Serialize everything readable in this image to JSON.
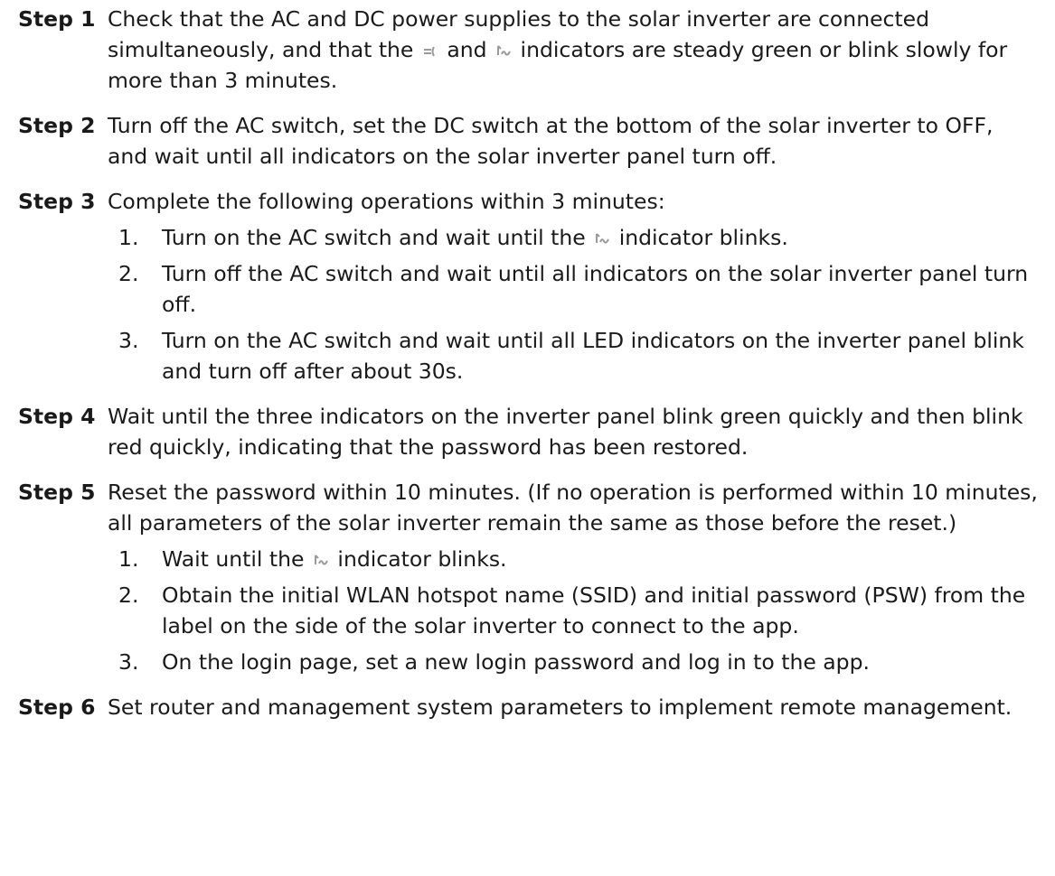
{
  "steps": [
    {
      "label": "Step 1",
      "parts": [
        "Check that the AC and DC power supplies to the solar inverter are connected simultaneously, and that the",
        "and",
        "indicators are steady green or blink slowly for more than 3 minutes."
      ],
      "icons": [
        "grid-indicator-icon",
        "communication-indicator-icon"
      ]
    },
    {
      "label": "Step 2",
      "text": "Turn off the AC switch, set the DC switch at the bottom of the solar inverter to OFF, and wait until all indicators on the solar inverter panel turn off."
    },
    {
      "label": "Step 3",
      "text": "Complete the following operations within 3 minutes:",
      "substeps": [
        {
          "num": "1.",
          "parts": [
            "Turn on the AC switch and wait until the",
            "indicator blinks."
          ],
          "icon": "communication-indicator-icon"
        },
        {
          "num": "2.",
          "text": "Turn off the AC switch and wait until all indicators on the solar inverter panel turn off."
        },
        {
          "num": "3.",
          "text": "Turn on the AC switch and wait until all LED indicators on the inverter panel blink and turn off after about 30s."
        }
      ]
    },
    {
      "label": "Step 4",
      "text": "Wait until the three indicators on the inverter panel blink green quickly and then blink red quickly, indicating that the password has been restored."
    },
    {
      "label": "Step 5",
      "text": "Reset the password within 10 minutes. (If no operation is performed within 10 minutes, all parameters of the solar inverter remain the same as those before the reset.)",
      "substeps": [
        {
          "num": "1.",
          "parts": [
            "Wait until the",
            "indicator blinks."
          ],
          "icon": "communication-indicator-icon"
        },
        {
          "num": "2.",
          "text": "Obtain the initial WLAN hotspot name (SSID) and initial password (PSW) from the label on the side of the solar inverter to connect to the app."
        },
        {
          "num": "3.",
          "text": "On the login page, set a new login password and log in to the app."
        }
      ]
    },
    {
      "label": "Step 6",
      "text": "Set router and management system parameters to implement remote management."
    }
  ]
}
